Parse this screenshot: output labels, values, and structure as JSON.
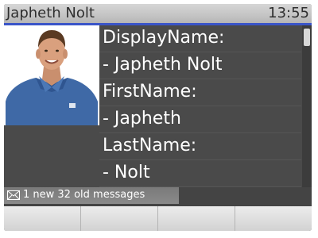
{
  "header": {
    "contact_name": "Japheth Nolt",
    "time": "13:55"
  },
  "contact": {
    "photo_icon": "contact-photo",
    "fields": [
      {
        "text": "DisplayName:"
      },
      {
        "text": "- Japheth Nolt"
      },
      {
        "text": "FirstName:"
      },
      {
        "text": "- Japheth"
      },
      {
        "text": "LastName:"
      },
      {
        "text": "- Nolt"
      }
    ]
  },
  "status": {
    "icon": "envelope-icon",
    "message": "1 new 32 old messages"
  },
  "softkeys": [
    {
      "label": ""
    },
    {
      "label": ""
    },
    {
      "label": ""
    },
    {
      "label": ""
    }
  ],
  "colors": {
    "accent": "#3a55c8",
    "background": "#4a4a4a"
  }
}
